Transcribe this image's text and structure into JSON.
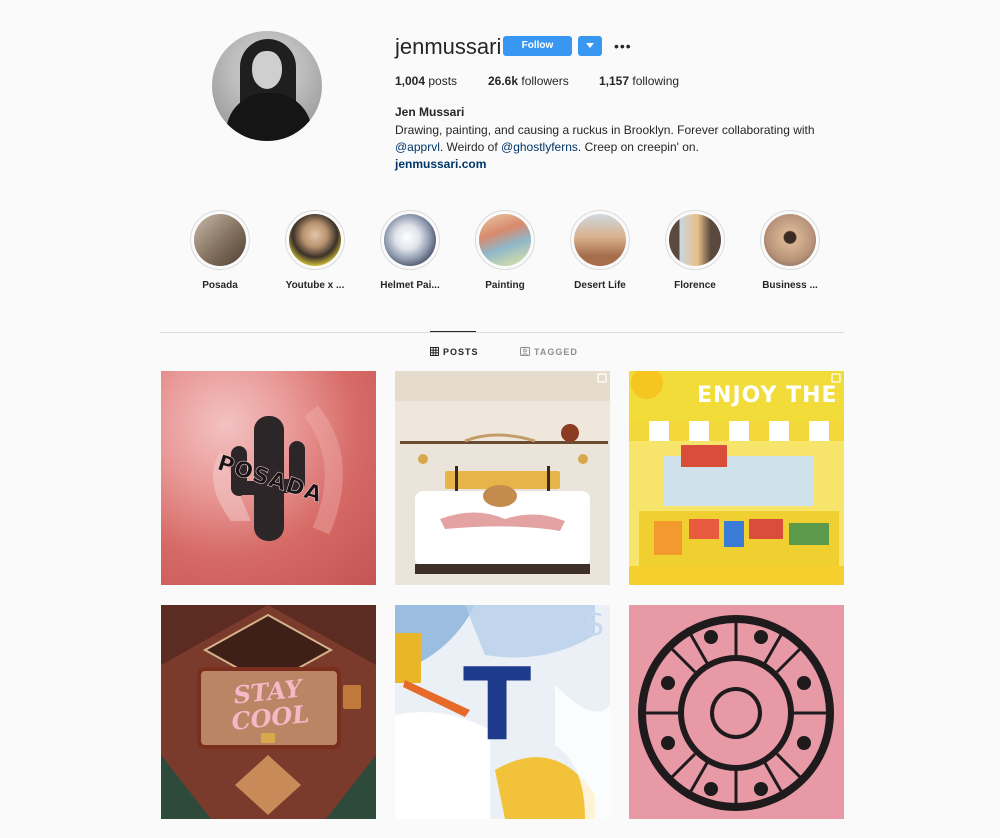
{
  "profile": {
    "username": "jenmussari",
    "follow_label": "Follow",
    "more_label": "•••",
    "stats": {
      "posts_count": "1,004",
      "posts_label": "posts",
      "followers_count": "26.6k",
      "followers_label": "followers",
      "following_count": "1,157",
      "following_label": "following"
    },
    "full_name": "Jen Mussari",
    "bio_line1": "Drawing, painting, and causing a ruckus in Brooklyn. Forever collaborating with",
    "bio_mention1": "@apprvl",
    "bio_mid": ". Weirdo of ",
    "bio_mention2": "@ghostlyferns",
    "bio_end": ". Creep on creepin' on.",
    "website": "jenmussari.com"
  },
  "highlights": [
    {
      "label": "Posada",
      "color": "#8c7a6a"
    },
    {
      "label": "Youtube x ...",
      "color": "#d9c24a"
    },
    {
      "label": "Helmet Pai...",
      "color": "#9aa3b5"
    },
    {
      "label": "Painting",
      "color": "#d9a27e"
    },
    {
      "label": "Desert Life",
      "color": "#c98f6a"
    },
    {
      "label": "Florence",
      "color": "#c9a07a"
    },
    {
      "label": "Business ...",
      "color": "#b8937a"
    }
  ],
  "tabs": {
    "posts": "POSTS",
    "tagged": "TAGGED"
  },
  "posts": [
    {
      "text": "POSADA"
    },
    {
      "text": ""
    },
    {
      "text": "ENJOY THE R"
    },
    {
      "text": "STAY COOL"
    },
    {
      "text": "T"
    },
    {
      "text": ""
    }
  ],
  "colors": {
    "accent": "#3897f0",
    "link": "#003569",
    "text": "#262626",
    "muted": "#8e8e8e",
    "border": "#dbdbdb",
    "background": "#fafafa"
  }
}
